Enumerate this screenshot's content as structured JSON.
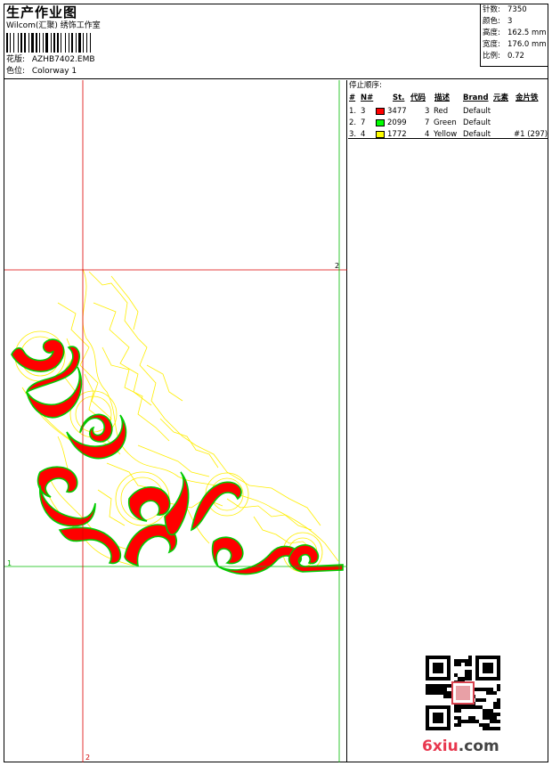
{
  "header": {
    "title": "生产作业图",
    "studio": "Wilcom(汇聚) 绣饰工作室",
    "design_label": "花版:",
    "design_value": "AZHB7402.EMB",
    "colorway_label": "色位:",
    "colorway_value": "Colorway 1"
  },
  "stats": [
    {
      "label": "针数:",
      "value": "7350"
    },
    {
      "label": "颜色:",
      "value": "3"
    },
    {
      "label": "高度:",
      "value": "162.5 mm"
    },
    {
      "label": "宽度:",
      "value": "176.0 mm"
    },
    {
      "label": "比例:",
      "value": "0.72"
    }
  ],
  "stop_sequence": {
    "caption": "停止顺序:",
    "headers": {
      "num": "#",
      "needle": "N#",
      "st": "St.",
      "code": "代码",
      "desc": "描述",
      "brand": "Brand",
      "element": "元素",
      "sequin": "金片铁"
    },
    "rows": [
      {
        "num": "1.",
        "needle": "3",
        "color": "#ff0000",
        "st": "3477",
        "code": "3",
        "desc": "Red",
        "brand": "Default",
        "extra": ""
      },
      {
        "num": "2.",
        "needle": "7",
        "color": "#00ff00",
        "st": "2099",
        "code": "7",
        "desc": "Green",
        "brand": "Default",
        "extra": ""
      },
      {
        "num": "3.",
        "needle": "4",
        "color": "#ffff00",
        "st": "1772",
        "code": "4",
        "desc": "Yellow",
        "brand": "Default",
        "extra": "#1 (297)"
      }
    ]
  },
  "guides": {
    "horizontal_red_label": "2",
    "horizontal_green_label": "1",
    "vertical_red_label": "2"
  },
  "colors": {
    "red": "#ff0000",
    "green": "#00cc00",
    "yellow": "#ffee00",
    "guide_red": "#dd0000",
    "guide_green": "#00bb00"
  },
  "watermark": {
    "logo_main": "6xiu",
    "logo_suffix": ".com"
  }
}
